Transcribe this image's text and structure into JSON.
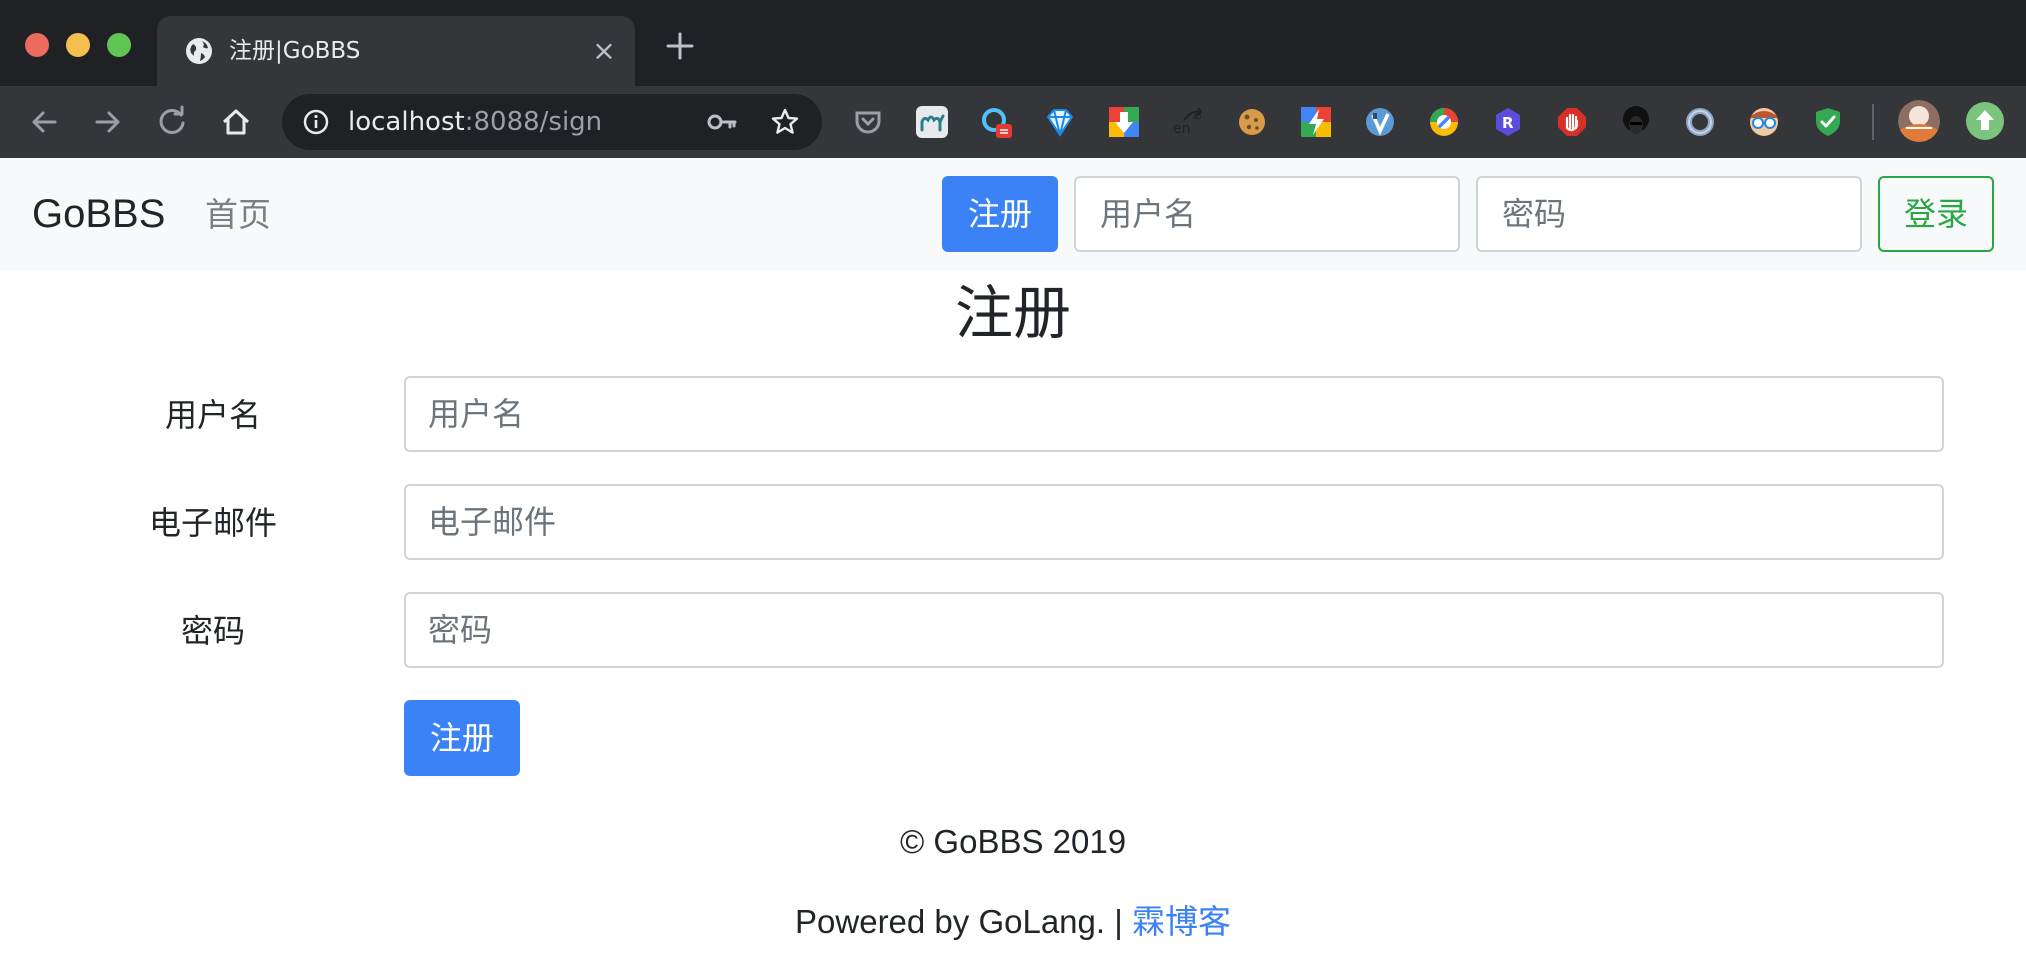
{
  "browser": {
    "tab_title": "注册|GoBBS",
    "tab_close": "×",
    "url_host": "localhost",
    "url_rest": ":8088/sign",
    "colors": {
      "frame": "#202124",
      "toolbar": "#35363a",
      "text": "#e8eaed",
      "url_dim": "#9aa0a6"
    }
  },
  "navbar": {
    "brand": "GoBBS",
    "home_label": "首页",
    "signup_label": "注册",
    "username_placeholder": "用户名",
    "password_placeholder": "密码",
    "login_label": "登录"
  },
  "form": {
    "title": "注册",
    "username_label": "用户名",
    "username_placeholder": "用户名",
    "email_label": "电子邮件",
    "email_placeholder": "电子邮件",
    "password_label": "密码",
    "password_placeholder": "密码",
    "submit_label": "注册"
  },
  "footer": {
    "copyright": "© GoBBS 2019",
    "powered_prefix": "Powered by GoLang. | ",
    "powered_link": "霖博客"
  },
  "extensions": [
    "pocket-icon",
    "camel-icon",
    "ocr-icon",
    "diamond-icon",
    "download-icon",
    "translate-icon",
    "cookie-icon",
    "lightning-icon",
    "vimium-icon",
    "chrome-colored-icon",
    "r-icon",
    "adblock-icon",
    "afro-icon",
    "ring-icon",
    "glasses-face-icon",
    "shield-check-icon",
    "avatar-extension-icon",
    "upload-arrow-icon"
  ],
  "theme": {
    "primary": "#3b82f6",
    "success": "#28a745",
    "navbar_bg": "#f8f9fa",
    "input_border": "#ced4da"
  }
}
